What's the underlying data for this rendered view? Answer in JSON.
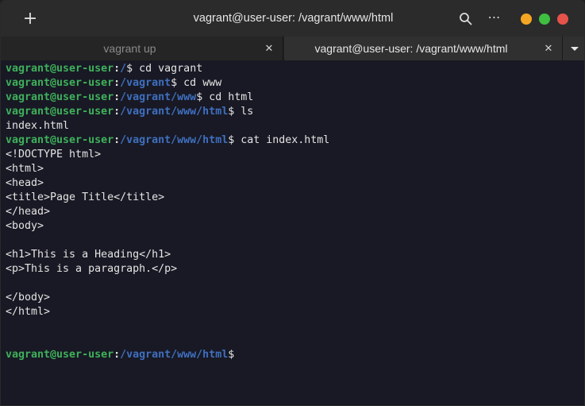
{
  "window": {
    "title": "vagrant@user-user: /vagrant/www/html",
    "new_tab_symbol": "+",
    "menu_symbol": "⋯",
    "controls": {
      "minimize_color": "#f5a623",
      "maximize_color": "#3fbf3f",
      "close_color": "#e5534b"
    }
  },
  "tabs": [
    {
      "label": "vagrant up",
      "active": false,
      "close": "✕"
    },
    {
      "label": "vagrant@user-user: /vagrant/www/html",
      "active": true,
      "close": "✕"
    }
  ],
  "terminal": {
    "user_host": "vagrant@user-user",
    "lines": [
      {
        "kind": "prompt",
        "path": "/",
        "command": " cd vagrant"
      },
      {
        "kind": "prompt",
        "path": "/vagrant",
        "command": " cd www"
      },
      {
        "kind": "prompt",
        "path": "/vagrant/www",
        "command": " cd html"
      },
      {
        "kind": "prompt",
        "path": "/vagrant/www/html",
        "command": " ls"
      },
      {
        "kind": "output",
        "text": "index.html"
      },
      {
        "kind": "prompt",
        "path": "/vagrant/www/html",
        "command": " cat index.html"
      },
      {
        "kind": "output",
        "text": "<!DOCTYPE html>"
      },
      {
        "kind": "output",
        "text": "<html>"
      },
      {
        "kind": "output",
        "text": "<head>"
      },
      {
        "kind": "output",
        "text": "<title>Page Title</title>"
      },
      {
        "kind": "output",
        "text": "</head>"
      },
      {
        "kind": "output",
        "text": "<body>"
      },
      {
        "kind": "output",
        "text": ""
      },
      {
        "kind": "output",
        "text": "<h1>This is a Heading</h1>"
      },
      {
        "kind": "output",
        "text": "<p>This is a paragraph.</p>"
      },
      {
        "kind": "output",
        "text": ""
      },
      {
        "kind": "output",
        "text": "</body>"
      },
      {
        "kind": "output",
        "text": "</html>"
      },
      {
        "kind": "output",
        "text": ""
      },
      {
        "kind": "output",
        "text": ""
      },
      {
        "kind": "prompt",
        "path": "/vagrant/www/html",
        "command": ""
      }
    ]
  },
  "colors": {
    "user": "#3fb05b",
    "path": "#3f6fbf",
    "text": "#e4e4e4",
    "background": "#181924"
  }
}
